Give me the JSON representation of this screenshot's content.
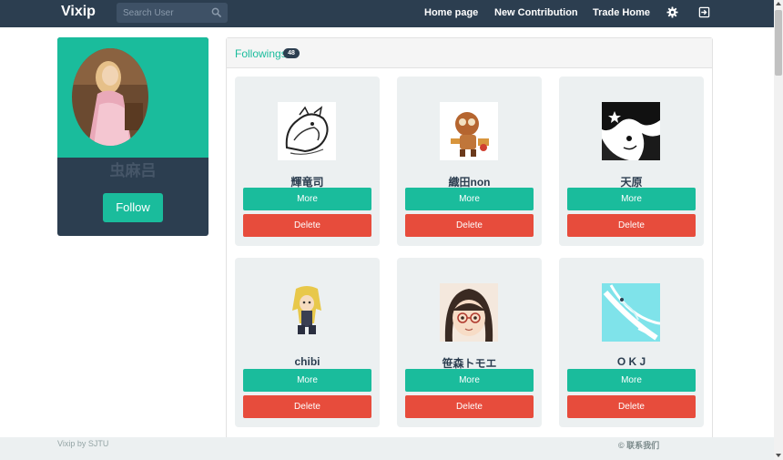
{
  "navbar": {
    "brand": "Vixip",
    "search_placeholder": "Search User",
    "links": [
      "Home page",
      "New Contribution",
      "Trade Home"
    ],
    "icons": [
      "gear-icon",
      "logout-icon"
    ]
  },
  "profile": {
    "name": "虫麻吕",
    "follow_label": "Follow",
    "colors": {
      "accent": "#1abc9c",
      "dark": "#2c3e50"
    }
  },
  "followings": {
    "title": "Followings",
    "count": "48",
    "more_label": "More",
    "delete_label": "Delete",
    "users": [
      {
        "name": "輝竜司"
      },
      {
        "name": "織田non"
      },
      {
        "name": "天原"
      },
      {
        "name": "chibi"
      },
      {
        "name": "笹森トモエ"
      },
      {
        "name": "O K J"
      }
    ]
  },
  "footer": {
    "left": "Vixip by SJTU",
    "right": "© 联系我们"
  },
  "colors": {
    "more": "#1abc9c",
    "delete": "#e74c3c",
    "navbar": "#2c3e50"
  }
}
